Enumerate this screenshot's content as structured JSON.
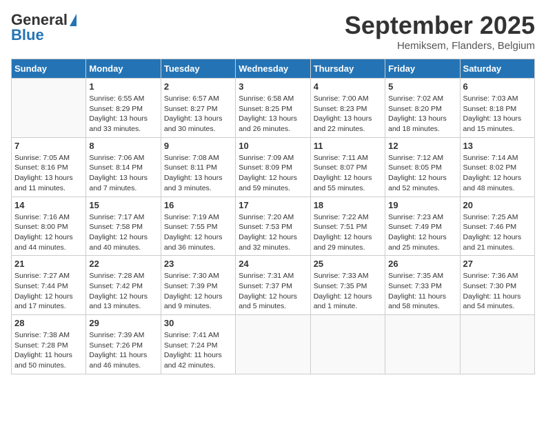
{
  "header": {
    "logo_line1": "General",
    "logo_line2": "Blue",
    "month": "September 2025",
    "location": "Hemiksem, Flanders, Belgium"
  },
  "days_of_week": [
    "Sunday",
    "Monday",
    "Tuesday",
    "Wednesday",
    "Thursday",
    "Friday",
    "Saturday"
  ],
  "weeks": [
    [
      {
        "day": "",
        "info": ""
      },
      {
        "day": "1",
        "info": "Sunrise: 6:55 AM\nSunset: 8:29 PM\nDaylight: 13 hours\nand 33 minutes."
      },
      {
        "day": "2",
        "info": "Sunrise: 6:57 AM\nSunset: 8:27 PM\nDaylight: 13 hours\nand 30 minutes."
      },
      {
        "day": "3",
        "info": "Sunrise: 6:58 AM\nSunset: 8:25 PM\nDaylight: 13 hours\nand 26 minutes."
      },
      {
        "day": "4",
        "info": "Sunrise: 7:00 AM\nSunset: 8:23 PM\nDaylight: 13 hours\nand 22 minutes."
      },
      {
        "day": "5",
        "info": "Sunrise: 7:02 AM\nSunset: 8:20 PM\nDaylight: 13 hours\nand 18 minutes."
      },
      {
        "day": "6",
        "info": "Sunrise: 7:03 AM\nSunset: 8:18 PM\nDaylight: 13 hours\nand 15 minutes."
      }
    ],
    [
      {
        "day": "7",
        "info": "Sunrise: 7:05 AM\nSunset: 8:16 PM\nDaylight: 13 hours\nand 11 minutes."
      },
      {
        "day": "8",
        "info": "Sunrise: 7:06 AM\nSunset: 8:14 PM\nDaylight: 13 hours\nand 7 minutes."
      },
      {
        "day": "9",
        "info": "Sunrise: 7:08 AM\nSunset: 8:11 PM\nDaylight: 13 hours\nand 3 minutes."
      },
      {
        "day": "10",
        "info": "Sunrise: 7:09 AM\nSunset: 8:09 PM\nDaylight: 12 hours\nand 59 minutes."
      },
      {
        "day": "11",
        "info": "Sunrise: 7:11 AM\nSunset: 8:07 PM\nDaylight: 12 hours\nand 55 minutes."
      },
      {
        "day": "12",
        "info": "Sunrise: 7:12 AM\nSunset: 8:05 PM\nDaylight: 12 hours\nand 52 minutes."
      },
      {
        "day": "13",
        "info": "Sunrise: 7:14 AM\nSunset: 8:02 PM\nDaylight: 12 hours\nand 48 minutes."
      }
    ],
    [
      {
        "day": "14",
        "info": "Sunrise: 7:16 AM\nSunset: 8:00 PM\nDaylight: 12 hours\nand 44 minutes."
      },
      {
        "day": "15",
        "info": "Sunrise: 7:17 AM\nSunset: 7:58 PM\nDaylight: 12 hours\nand 40 minutes."
      },
      {
        "day": "16",
        "info": "Sunrise: 7:19 AM\nSunset: 7:55 PM\nDaylight: 12 hours\nand 36 minutes."
      },
      {
        "day": "17",
        "info": "Sunrise: 7:20 AM\nSunset: 7:53 PM\nDaylight: 12 hours\nand 32 minutes."
      },
      {
        "day": "18",
        "info": "Sunrise: 7:22 AM\nSunset: 7:51 PM\nDaylight: 12 hours\nand 29 minutes."
      },
      {
        "day": "19",
        "info": "Sunrise: 7:23 AM\nSunset: 7:49 PM\nDaylight: 12 hours\nand 25 minutes."
      },
      {
        "day": "20",
        "info": "Sunrise: 7:25 AM\nSunset: 7:46 PM\nDaylight: 12 hours\nand 21 minutes."
      }
    ],
    [
      {
        "day": "21",
        "info": "Sunrise: 7:27 AM\nSunset: 7:44 PM\nDaylight: 12 hours\nand 17 minutes."
      },
      {
        "day": "22",
        "info": "Sunrise: 7:28 AM\nSunset: 7:42 PM\nDaylight: 12 hours\nand 13 minutes."
      },
      {
        "day": "23",
        "info": "Sunrise: 7:30 AM\nSunset: 7:39 PM\nDaylight: 12 hours\nand 9 minutes."
      },
      {
        "day": "24",
        "info": "Sunrise: 7:31 AM\nSunset: 7:37 PM\nDaylight: 12 hours\nand 5 minutes."
      },
      {
        "day": "25",
        "info": "Sunrise: 7:33 AM\nSunset: 7:35 PM\nDaylight: 12 hours\nand 1 minute."
      },
      {
        "day": "26",
        "info": "Sunrise: 7:35 AM\nSunset: 7:33 PM\nDaylight: 11 hours\nand 58 minutes."
      },
      {
        "day": "27",
        "info": "Sunrise: 7:36 AM\nSunset: 7:30 PM\nDaylight: 11 hours\nand 54 minutes."
      }
    ],
    [
      {
        "day": "28",
        "info": "Sunrise: 7:38 AM\nSunset: 7:28 PM\nDaylight: 11 hours\nand 50 minutes."
      },
      {
        "day": "29",
        "info": "Sunrise: 7:39 AM\nSunset: 7:26 PM\nDaylight: 11 hours\nand 46 minutes."
      },
      {
        "day": "30",
        "info": "Sunrise: 7:41 AM\nSunset: 7:24 PM\nDaylight: 11 hours\nand 42 minutes."
      },
      {
        "day": "",
        "info": ""
      },
      {
        "day": "",
        "info": ""
      },
      {
        "day": "",
        "info": ""
      },
      {
        "day": "",
        "info": ""
      }
    ]
  ]
}
